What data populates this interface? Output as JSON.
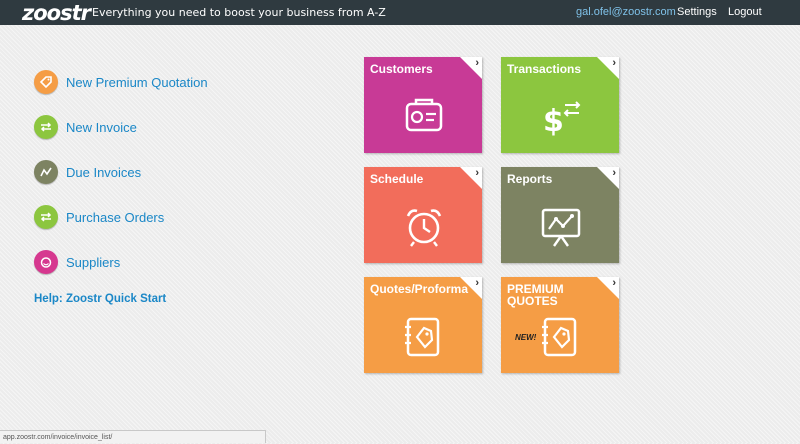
{
  "header": {
    "logo": "zoostr",
    "tagline": "Everything you need to boost your business from A-Z",
    "user_email": "gal.ofel@zoostr.com",
    "settings": "Settings",
    "logout": "Logout"
  },
  "actions": [
    {
      "label": "New Premium Quotation",
      "icon": "price-tag-icon",
      "color": "#f59d45"
    },
    {
      "label": "New Invoice",
      "icon": "exchange-arrows-icon",
      "color": "#8cc63f"
    },
    {
      "label": "Due Invoices",
      "icon": "trend-line-icon",
      "color": "#7d8362"
    },
    {
      "label": "Purchase Orders",
      "icon": "exchange-arrows-icon",
      "color": "#8cc63f"
    },
    {
      "label": "Suppliers",
      "icon": "face-icon",
      "color": "#d6388f"
    }
  ],
  "help_link": "Help: Zoostr Quick Start",
  "tiles": [
    {
      "title": "Customers",
      "color": "#c83a96",
      "icon": "contact-card-icon"
    },
    {
      "title": "Transactions",
      "color": "#8cc63f",
      "icon": "dollar-exchange-icon"
    },
    {
      "title": "Schedule",
      "color": "#f26d5b",
      "icon": "alarm-clock-icon"
    },
    {
      "title": "Reports",
      "color": "#7d8362",
      "icon": "presentation-chart-icon"
    },
    {
      "title": "Quotes/Proforma",
      "color": "#f59d45",
      "icon": "notebook-tag-icon"
    },
    {
      "title": "PREMIUM QUOTES",
      "color": "#f59d45",
      "icon": "notebook-tag-icon",
      "badge": "NEW!"
    }
  ],
  "status_bar": "app.zoostr.com/invoice/invoice_list/"
}
